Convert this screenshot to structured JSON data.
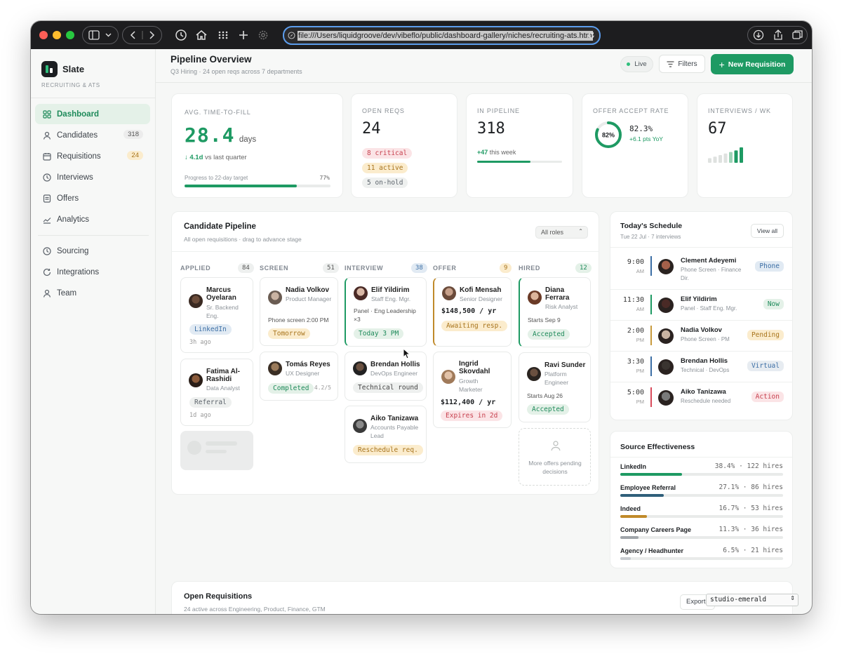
{
  "browser": {
    "url": "file:///Users/liquidgroove/dev/vibeflo/public/dashboard-gallery/niches/recruiting-ats.htm"
  },
  "sidebar": {
    "brand": "Slate",
    "subtitle": "RECRUITING & ATS",
    "items": [
      {
        "label": "Dashboard",
        "icon": "grid-icon"
      },
      {
        "label": "Candidates",
        "count": "318",
        "icon": "user-icon"
      },
      {
        "label": "Requisitions",
        "count": "24",
        "icon": "calendar-icon"
      },
      {
        "label": "Interviews",
        "icon": "clock-icon"
      },
      {
        "label": "Offers",
        "icon": "document-icon"
      },
      {
        "label": "Analytics",
        "icon": "trend-icon"
      }
    ],
    "items2": [
      {
        "label": "Sourcing",
        "icon": "clock-icon"
      },
      {
        "label": "Integrations",
        "icon": "refresh-icon"
      },
      {
        "label": "Team",
        "icon": "user-icon"
      }
    ]
  },
  "header": {
    "title": "Pipeline Overview",
    "subtitle": "Q3 Hiring · 24 open reqs across 7 departments",
    "live": "Live",
    "filters": "Filters",
    "new_req": "New Requisition"
  },
  "kpi": {
    "ttf": {
      "label": "AVG. TIME-TO-FILL",
      "value": "28.4",
      "unit": "days",
      "delta": "↓ 4.1d",
      "delta_text": "vs last quarter",
      "progress_label": "Progress to 22-day target",
      "progress_pct": "77%",
      "progress": 0.77
    },
    "open": {
      "label": "OPEN REQS",
      "value": "24",
      "critical": "8 critical",
      "active": "11 active",
      "onhold": "5 on-hold"
    },
    "pipeline": {
      "label": "IN PIPELINE",
      "value": "318",
      "delta": "+47",
      "delta_text": "this week",
      "progress": 0.63
    },
    "offer": {
      "label": "OFFER ACCEPT RATE",
      "ring": "82%",
      "ring_value": 0.82,
      "value": "82.3%",
      "delta": "+6.1 pts YoY"
    },
    "interviews": {
      "label": "INTERVIEWS / WK",
      "value": "67",
      "spark": [
        3,
        4,
        5,
        6,
        7,
        8,
        10
      ]
    }
  },
  "pipeline": {
    "title": "Candidate Pipeline",
    "subtitle": "All open requisitions · drag to advance stage",
    "filter": "All roles",
    "columns": [
      {
        "name": "APPLIED",
        "count": "84"
      },
      {
        "name": "SCREEN",
        "count": "51"
      },
      {
        "name": "INTERVIEW",
        "count": "38"
      },
      {
        "name": "OFFER",
        "count": "9"
      },
      {
        "name": "HIRED",
        "count": "12"
      }
    ],
    "applied": [
      {
        "name": "Marcus Oyelaran",
        "role": "Sr. Backend Eng.",
        "tag": "LinkedIn",
        "meta": "3h ago"
      },
      {
        "name": "Fatima Al-Rashidi",
        "role": "Data Analyst",
        "tag": "Referral",
        "meta": "1d ago"
      }
    ],
    "screen": [
      {
        "name": "Nadia Volkov",
        "role": "Product Manager",
        "note": "Phone screen 2:00 PM",
        "tag": "Tomorrow"
      },
      {
        "name": "Tomás Reyes",
        "role": "UX Designer",
        "tag": "Completed",
        "score": "4.2/5"
      }
    ],
    "interview": [
      {
        "name": "Elif Yildirim",
        "role": "Staff Eng. Mgr.",
        "note": "Panel · Eng Leadership ×3",
        "tag": "Today 3 PM"
      },
      {
        "name": "Brendan Hollis",
        "role": "DevOps Engineer",
        "tag": "Technical round"
      },
      {
        "name": "Aiko Tanizawa",
        "role": "Accounts Payable Lead",
        "tag": "Reschedule req."
      }
    ],
    "offer": [
      {
        "name": "Kofi Mensah",
        "role": "Senior Designer",
        "amount": "$148,500 / yr",
        "tag": "Awaiting resp."
      },
      {
        "name": "Ingrid Skovdahl",
        "role": "Growth Marketer",
        "amount": "$112,400 / yr",
        "tag": "Expires in 2d"
      }
    ],
    "hired": [
      {
        "name": "Diana Ferrara",
        "role": "Risk Analyst",
        "note": "Starts Sep 9",
        "tag": "Accepted"
      },
      {
        "name": "Ravi Sunder",
        "role": "Platform Engineer",
        "note": "Starts Aug 26",
        "tag": "Accepted"
      }
    ],
    "more_offers": "More offers pending decisions"
  },
  "schedule": {
    "title": "Today's Schedule",
    "subtitle": "Tue 22 Jul · 7 interviews",
    "view_all": "View all",
    "items": [
      {
        "time": "9:00",
        "ampm": "AM",
        "name": "Clement Adeyemi",
        "detail": "Phone Screen · Finance Dir.",
        "tag": "Phone",
        "color": "#3b6ea5"
      },
      {
        "time": "11:30",
        "ampm": "AM",
        "name": "Elif Yildirim",
        "detail": "Panel · Staff Eng. Mgr.",
        "tag": "Now",
        "color": "#1e9a63"
      },
      {
        "time": "2:00",
        "ampm": "PM",
        "name": "Nadia Volkov",
        "detail": "Phone Screen · PM",
        "tag": "Pending",
        "color": "#c89a3c"
      },
      {
        "time": "3:30",
        "ampm": "PM",
        "name": "Brendan Hollis",
        "detail": "Technical · DevOps",
        "tag": "Virtual",
        "color": "#3b6ea5"
      },
      {
        "time": "5:00",
        "ampm": "PM",
        "name": "Aiko Tanizawa",
        "detail": "Reschedule needed",
        "tag": "Action",
        "color": "#d94a5a"
      }
    ]
  },
  "sources": {
    "title": "Source Effectiveness",
    "items": [
      {
        "name": "LinkedIn",
        "stat": "38.4% · 122 hires",
        "share": 0.384,
        "color": "#1e9a63"
      },
      {
        "name": "Employee Referral",
        "stat": "27.1% · 86 hires",
        "share": 0.271,
        "color": "#2f5f7a"
      },
      {
        "name": "Indeed",
        "stat": "16.7% · 53 hires",
        "share": 0.167,
        "color": "#c08a2a"
      },
      {
        "name": "Company Careers Page",
        "stat": "11.3% · 36 hires",
        "share": 0.113,
        "color": "#a0a5aa"
      },
      {
        "name": "Agency / Headhunter",
        "stat": "6.5% · 21 hires",
        "share": 0.065,
        "color": "#c8ccd0"
      }
    ]
  },
  "requisitions": {
    "title": "Open Requisitions",
    "subtitle": "24 active across Engineering, Product, Finance, GTM",
    "export": "Export",
    "theme": "studio-emerald"
  }
}
